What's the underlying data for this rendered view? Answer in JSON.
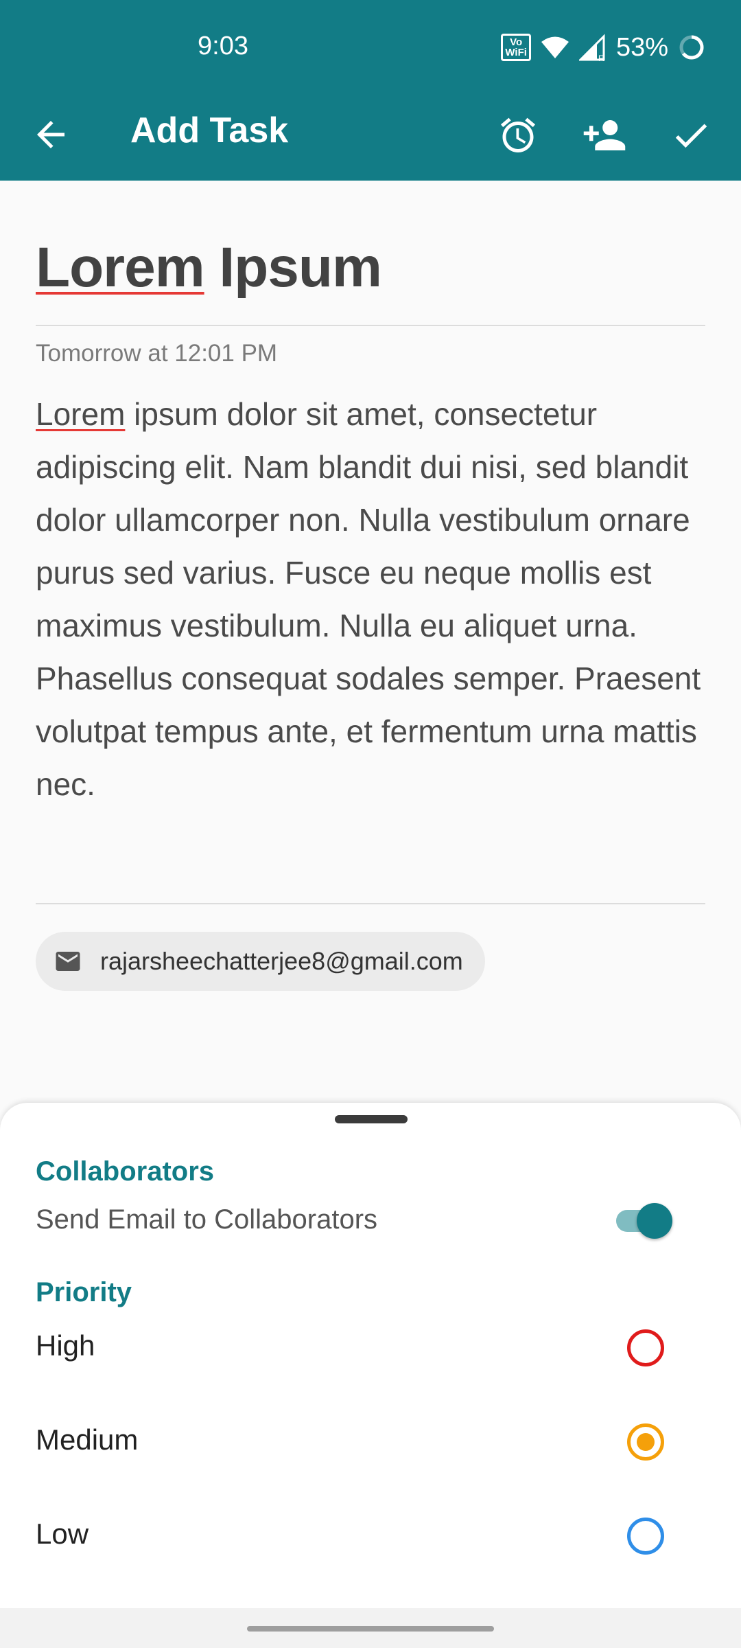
{
  "status_bar": {
    "time": "9:03",
    "volte_label": "Vo\nWiFi",
    "battery_percent": "53%"
  },
  "app_bar": {
    "title": "Add Task",
    "actions": [
      "alarm-icon",
      "add-collaborator-icon",
      "check-icon"
    ]
  },
  "task": {
    "title_first_word": "Lorem",
    "title_rest": " Ipsum",
    "due": "Tomorrow at 12:01 PM",
    "description_first_word": "Lorem",
    "description_rest": " ipsum dolor sit amet, consectetur adipiscing elit. Nam blandit dui nisi, sed blandit dolor ullamcorper non. Nulla vestibulum ornare purus sed varius. Fusce eu neque mollis est maximus vestibulum. Nulla eu aliquet urna. Phasellus consequat sodales semper. Praesent volutpat tempus ante, et fermentum urna mattis nec.",
    "collaborator_email": "rajarsheechatterjee8@gmail.com"
  },
  "sheet": {
    "collaborators_heading": "Collaborators",
    "send_email_label": "Send Email to Collaborators",
    "send_email_enabled": true,
    "priority_heading": "Priority",
    "priorities": [
      {
        "label": "High",
        "color": "#e01b1b",
        "selected": false
      },
      {
        "label": "Medium",
        "color": "#f5a00a",
        "selected": true
      },
      {
        "label": "Low",
        "color": "#2f8ee8",
        "selected": false
      }
    ]
  },
  "colors": {
    "primary": "#127c86",
    "spellcheck_underline": "#e53935"
  }
}
